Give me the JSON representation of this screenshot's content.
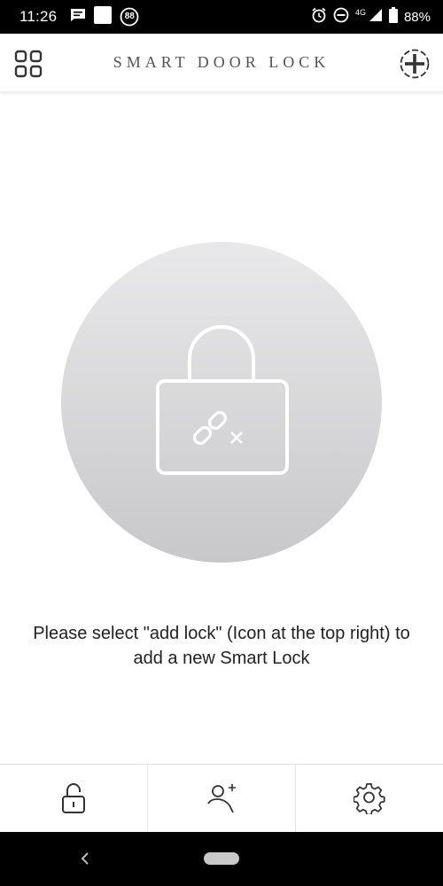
{
  "status_bar": {
    "time": "11:26",
    "notification_badge": "88",
    "network_type": "4G",
    "battery_percent": "88%",
    "icons": [
      "message-icon",
      "white-square-icon",
      "badge-88-icon",
      "alarm-icon",
      "do-not-disturb-icon",
      "signal-icon",
      "battery-icon"
    ]
  },
  "header": {
    "title": "SMART DOOR LOCK",
    "left_icon": "grid-menu-icon",
    "right_icon": "add-lock-icon"
  },
  "main": {
    "illustration_icon": "unlinked-lock-icon",
    "instruction": "Please select \"add lock\" (Icon at the top right) to add a new Smart Lock"
  },
  "tab_bar": {
    "tabs": [
      {
        "icon": "padlock-icon"
      },
      {
        "icon": "add-user-icon"
      },
      {
        "icon": "settings-gear-icon"
      }
    ]
  },
  "colors": {
    "status_bar_bg": "#000000",
    "header_bg": "#ffffff",
    "title_text": "#555555",
    "circle_top": "#e9e9ea",
    "circle_bottom": "#c8c7c9",
    "icon_stroke": "#333333"
  }
}
